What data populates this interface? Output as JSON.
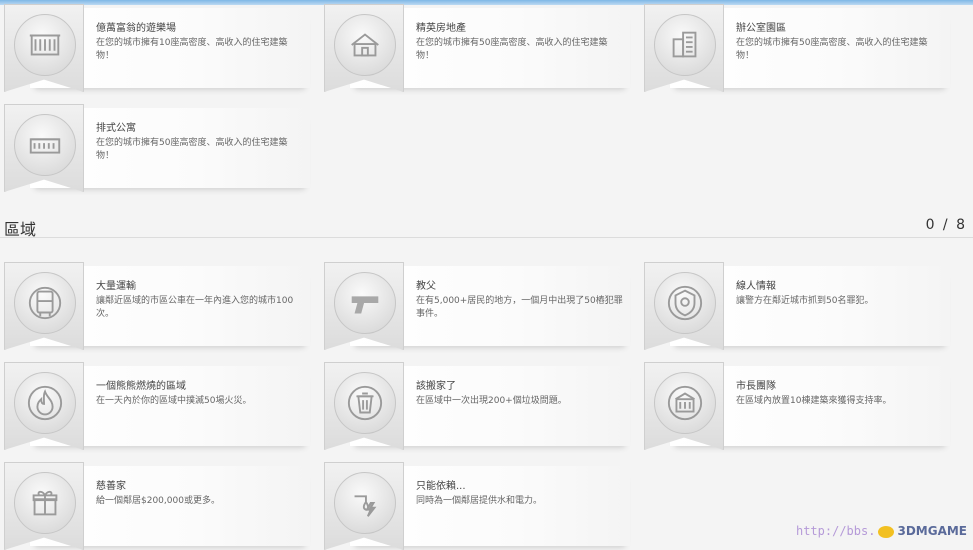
{
  "top_cards": [
    {
      "title": "億萬富翁的遊樂場",
      "desc": "在您的城市擁有10座高密度、高收入的住宅建築物！",
      "icon": "mansion-icon"
    },
    {
      "title": "精英房地產",
      "desc": "在您的城市擁有50座高密度、高收入的住宅建築物！",
      "icon": "house-icon"
    },
    {
      "title": "辦公室園區",
      "desc": "在您的城市擁有50座高密度、高收入的住宅建築物！",
      "icon": "office-tower-icon"
    },
    {
      "title": "排式公寓",
      "desc": "在您的城市擁有50座高密度、高收入的住宅建築物！",
      "icon": "rowhouse-icon"
    }
  ],
  "section": {
    "title": "區域",
    "count": "0 / 8"
  },
  "region_cards": [
    {
      "title": "大量運輸",
      "desc": "讓鄰近區域的市區公車在一年內進入您的城市100次。",
      "icon": "bus-icon"
    },
    {
      "title": "教父",
      "desc": "在有5,000+居民的地方，一個月中出現了50樁犯罪事件。",
      "icon": "gun-icon"
    },
    {
      "title": "線人情報",
      "desc": "讓警方在鄰近城市抓到50名罪犯。",
      "icon": "police-badge-icon"
    },
    {
      "title": "一個熊熊燃燒的區域",
      "desc": "在一天內於你的區域中撲滅50場火災。",
      "icon": "fire-icon"
    },
    {
      "title": "該搬家了",
      "desc": "在區域中一次出現200+個垃圾問題。",
      "icon": "trash-icon"
    },
    {
      "title": "市長團隊",
      "desc": "在區域內放置10棟建築來獲得支持率。",
      "icon": "city-hall-icon"
    },
    {
      "title": "慈善家",
      "desc": "給一個鄰居$200,000或更多。",
      "icon": "gift-icon"
    },
    {
      "title": "只能依賴...",
      "desc": "同時為一個鄰居提供水和電力。",
      "icon": "water-power-icon"
    }
  ],
  "watermark": {
    "url": "http://bbs.",
    "brand": "3DMGAME"
  }
}
